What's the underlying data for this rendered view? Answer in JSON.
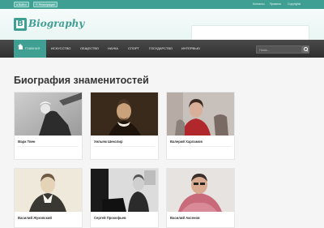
{
  "topbar": {
    "login_label": "Войти",
    "register_label": "Регистрация",
    "links": [
      "Контакты",
      "Правила",
      "Copyrights"
    ]
  },
  "logo": {
    "letter": "B",
    "text": "Biography"
  },
  "nav": {
    "home_label": "Главная",
    "items": [
      "Искусство",
      "Общество",
      "Наука",
      "Спорт",
      "Государство",
      "Интервью"
    ],
    "search_placeholder": "Поиск..."
  },
  "page_title": "Биография знаменитостей",
  "cards": [
    {
      "name": "Марк Твен"
    },
    {
      "name": "Уильям Шекспир"
    },
    {
      "name": "Валерий Харламов"
    },
    {
      "name": "Василий Жуковский"
    },
    {
      "name": "Сергей Прокофьев"
    },
    {
      "name": "Василий Аксенов"
    }
  ],
  "colors": {
    "accent": "#3f9f92",
    "nav_bg": "#333333"
  }
}
